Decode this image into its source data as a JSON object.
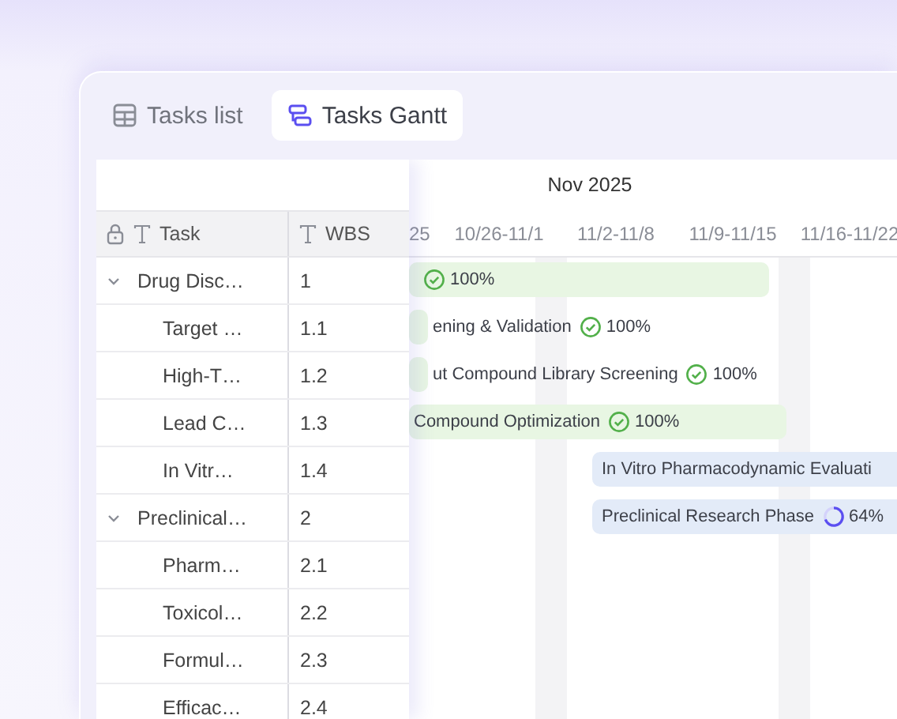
{
  "tabs": [
    {
      "label": "Tasks list",
      "selected": false
    },
    {
      "label": "Tasks Gantt",
      "selected": true
    }
  ],
  "table": {
    "columns": [
      {
        "label": "Task",
        "locked": true
      },
      {
        "label": "WBS",
        "locked": false
      }
    ],
    "rows": [
      {
        "task": "Drug Disc…",
        "wbs": "1",
        "expanded": true,
        "children": [
          {
            "task": "Target …",
            "wbs": "1.1"
          },
          {
            "task": "High-T…",
            "wbs": "1.2"
          },
          {
            "task": "Lead C…",
            "wbs": "1.3"
          },
          {
            "task": "In Vitr…",
            "wbs": "1.4"
          }
        ]
      },
      {
        "task": "Preclinical…",
        "wbs": "2",
        "expanded": true,
        "children": [
          {
            "task": "Pharm…",
            "wbs": "2.1"
          },
          {
            "task": "Toxicol…",
            "wbs": "2.2"
          },
          {
            "task": "Formul…",
            "wbs": "2.3"
          },
          {
            "task": "Efficac…",
            "wbs": "2.4"
          }
        ]
      }
    ]
  },
  "gantt": {
    "month": "Nov 2025",
    "weeks": [
      "25",
      "10/26-11/1",
      "11/2-11/8",
      "11/9-11/15",
      "11/16-11/22"
    ],
    "bars": [
      {
        "kind": "done",
        "progress": "100%"
      },
      {
        "kind": "done",
        "label": "ening & Validation",
        "progress": "100%"
      },
      {
        "kind": "done",
        "label": "ut Compound Library Screening",
        "progress": "100%"
      },
      {
        "kind": "done",
        "label": "Compound Optimization",
        "progress": "100%"
      },
      {
        "kind": "in-progress",
        "label": "In Vitro Pharmacodynamic Evaluati"
      },
      {
        "kind": "in-progress",
        "label": "Preclinical Research Phase",
        "progress": "64%"
      }
    ]
  }
}
